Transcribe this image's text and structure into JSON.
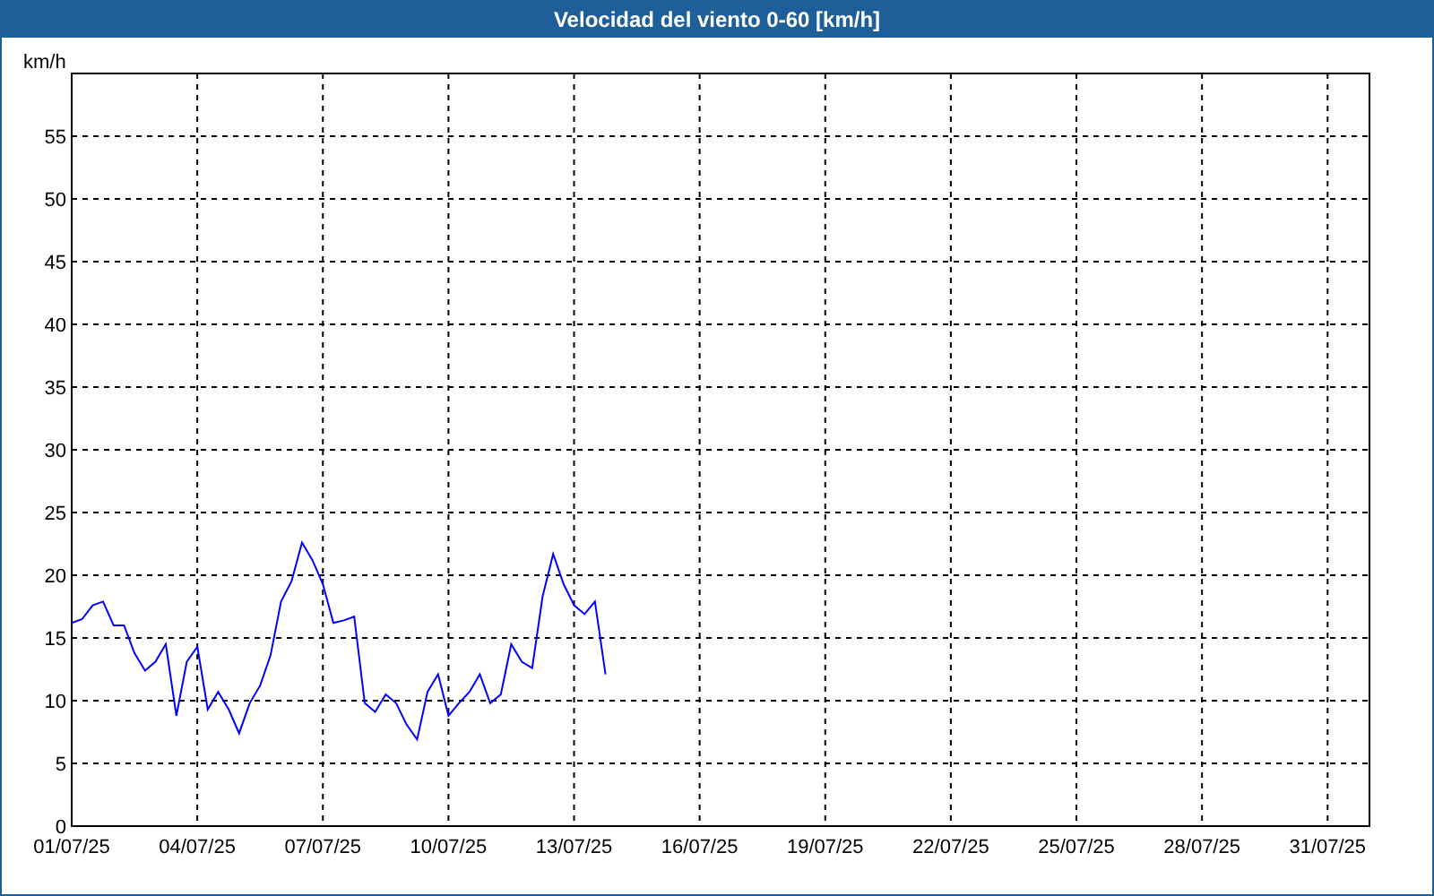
{
  "window": {
    "title": "Velocidad del viento 0-60 [km/h]"
  },
  "chart": {
    "chart_data": {
      "type": "line",
      "grid": true,
      "ylabel": "km/h",
      "ylim": [
        0,
        60
      ],
      "yticks": [
        0,
        5,
        10,
        15,
        20,
        25,
        30,
        35,
        40,
        45,
        50,
        55
      ],
      "categories": [
        "01/07/25",
        null,
        null,
        null,
        null,
        null,
        null,
        null,
        null,
        null,
        null,
        null,
        "04/07/25",
        null,
        null,
        null,
        null,
        null,
        null,
        null,
        null,
        null,
        null,
        null,
        "07/07/25",
        null,
        null,
        null,
        null,
        null,
        null,
        null,
        null,
        null,
        null,
        null,
        "10/07/25",
        null,
        null,
        null,
        null,
        null,
        null,
        null,
        null,
        null,
        null,
        null,
        "13/07/25",
        null,
        null,
        null,
        null,
        null,
        null,
        null,
        null,
        null,
        null,
        null,
        "16/07/25",
        null,
        null,
        null,
        null,
        null,
        null,
        null,
        null,
        null,
        null,
        null,
        "19/07/25",
        null,
        null,
        null,
        null,
        null,
        null,
        null,
        null,
        null,
        null,
        null,
        "22/07/25",
        null,
        null,
        null,
        null,
        null,
        null,
        null,
        null,
        null,
        null,
        null,
        "25/07/25",
        null,
        null,
        null,
        null,
        null,
        null,
        null,
        null,
        null,
        null,
        null,
        "28/07/25",
        null,
        null,
        null,
        null,
        null,
        null,
        null,
        null,
        null,
        null,
        null,
        "31/07/25",
        null,
        null,
        null,
        null
      ],
      "series": [
        {
          "color": "#0000ff",
          "values": [
            16.2,
            16.5,
            17.6,
            17.9,
            16.0,
            16.0,
            13.8,
            12.4,
            13.1,
            14.5,
            8.8,
            13.1,
            14.3,
            9.3,
            10.7,
            9.3,
            7.4,
            9.8,
            11.2,
            13.6,
            17.9,
            19.5,
            22.6,
            21.2,
            19.3,
            16.2,
            16.4,
            16.7,
            9.8,
            9.1,
            10.5,
            9.8,
            8.1,
            6.9,
            10.7,
            12.1,
            8.8,
            9.8,
            10.7,
            12.1,
            9.8,
            10.5,
            14.5,
            13.1,
            12.6,
            18.3,
            21.7,
            19.3,
            17.6,
            16.9,
            17.9,
            12.1,
            null,
            null,
            null,
            null,
            null,
            null,
            null,
            null,
            null,
            null,
            null,
            null,
            null,
            null,
            null,
            null,
            null,
            null,
            null,
            null,
            null,
            null,
            null,
            null,
            null,
            null,
            null,
            null,
            null,
            null,
            null,
            null,
            null,
            null,
            null,
            null,
            null,
            null,
            null,
            null,
            null,
            null,
            null,
            null,
            null,
            null,
            null,
            null,
            null,
            null,
            null,
            null,
            null,
            null,
            null,
            null,
            null,
            null,
            null,
            null,
            null,
            null,
            null,
            null,
            null,
            null,
            null,
            null,
            null,
            null,
            null,
            null,
            null
          ]
        }
      ]
    }
  }
}
